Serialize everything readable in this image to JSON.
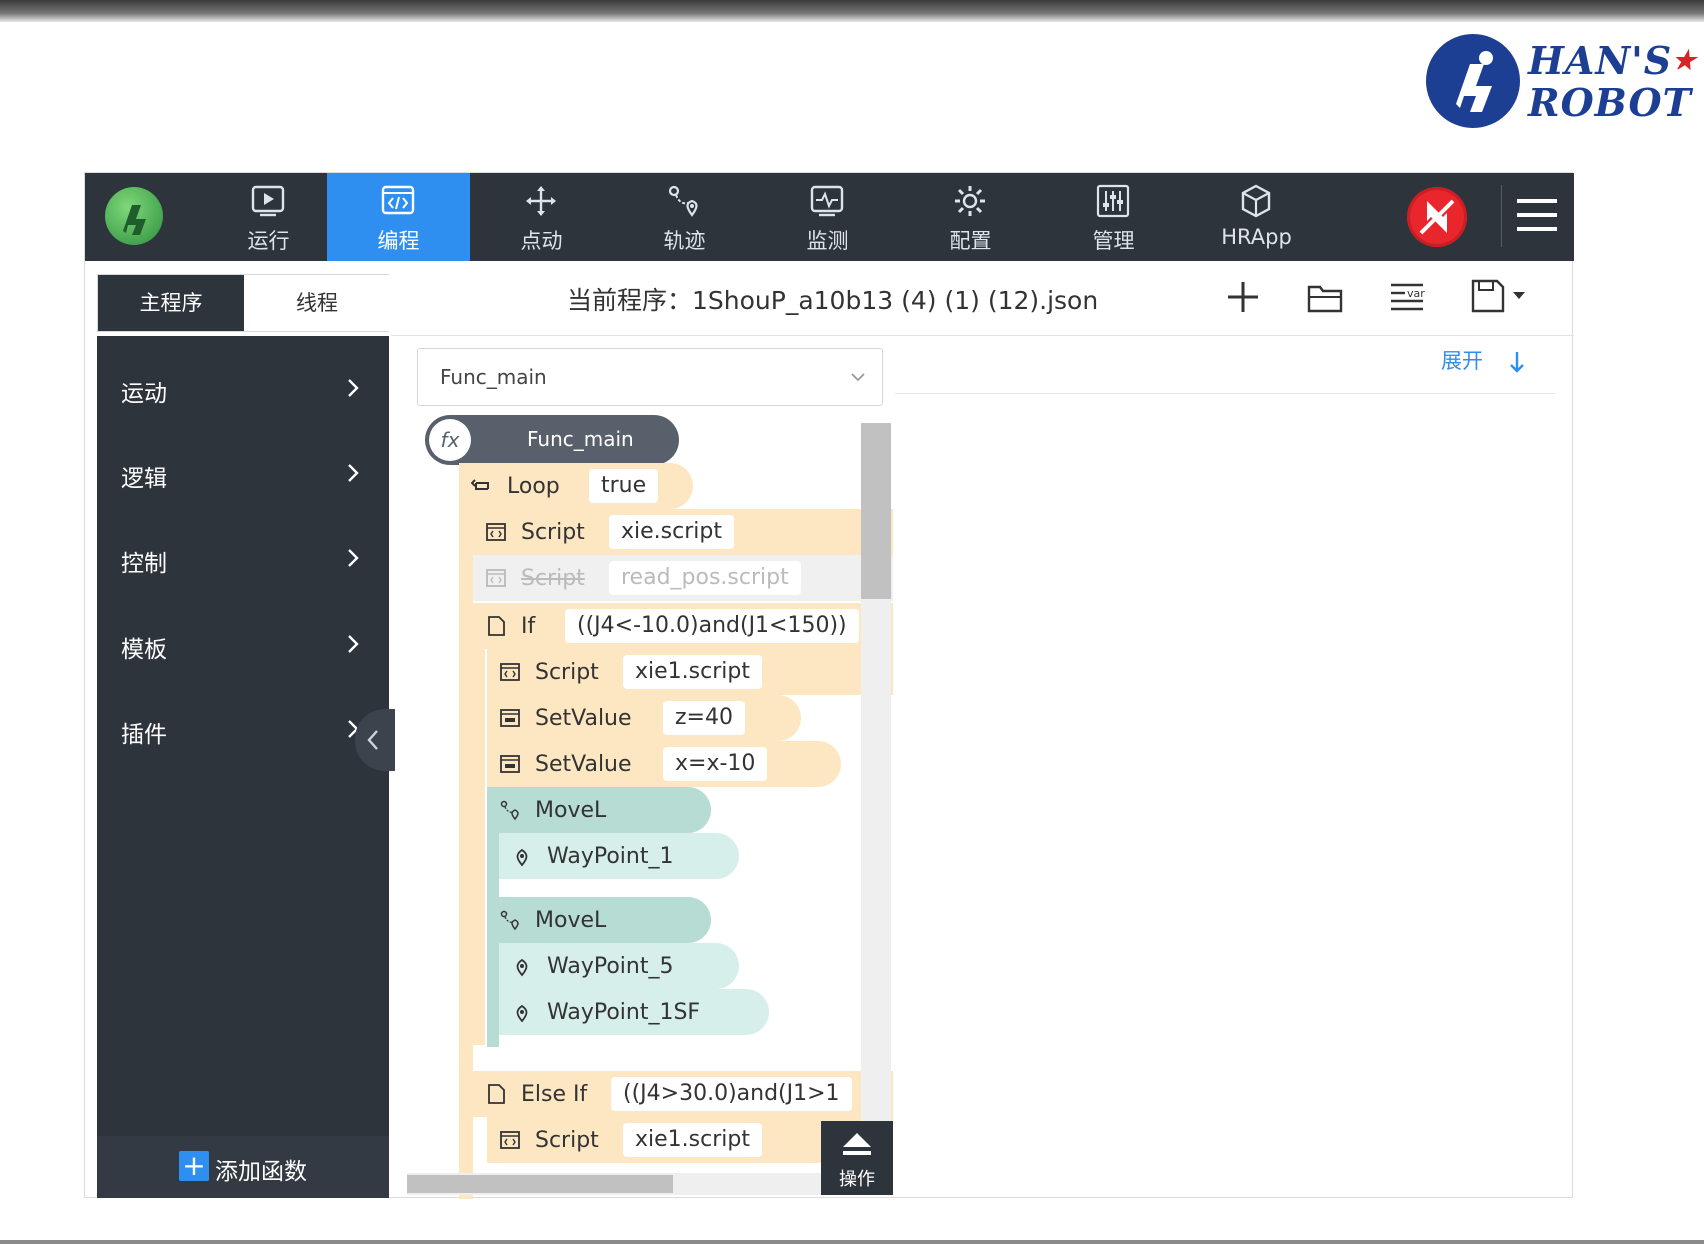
{
  "brand": {
    "line1": "HAN'S",
    "line2": "ROBOT",
    "color": "#1c3f94",
    "star_color": "#d6232a"
  },
  "nav": {
    "items": [
      {
        "label": "运行",
        "icon": "play-icon"
      },
      {
        "label": "编程",
        "icon": "code-icon",
        "active": true
      },
      {
        "label": "点动",
        "icon": "move-arrows-icon"
      },
      {
        "label": "轨迹",
        "icon": "trajectory-icon"
      },
      {
        "label": "监测",
        "icon": "monitor-icon"
      },
      {
        "label": "配置",
        "icon": "gear-icon"
      },
      {
        "label": "管理",
        "icon": "sliders-icon"
      },
      {
        "label": "HRApp",
        "icon": "cube-icon"
      }
    ],
    "accent": "#2f8ff0",
    "estop_color": "#e8262c"
  },
  "tabs": {
    "main": "主程序",
    "thread": "线程"
  },
  "sidebar": {
    "items": [
      "运动",
      "逻辑",
      "控制",
      "模板",
      "插件"
    ],
    "add_function": "添加函数"
  },
  "header": {
    "current_program": "当前程序：1ShouP_a10b13 (4) (1) (12).json"
  },
  "func_select": {
    "value": "Func_main"
  },
  "blocks": {
    "func": "Func_main",
    "loop": {
      "name": "Loop",
      "arg": "true"
    },
    "script1": {
      "name": "Script",
      "arg": "xie.script"
    },
    "script2": {
      "name": "Script",
      "arg": "read_pos.script"
    },
    "if": {
      "name": "If",
      "arg": "((J4<-10.0)and(J1<150))"
    },
    "script3": {
      "name": "Script",
      "arg": "xie1.script"
    },
    "setvalue1": {
      "name": "SetValue",
      "arg": "z=40"
    },
    "setvalue2": {
      "name": "SetValue",
      "arg": "x=x-10"
    },
    "movel1": {
      "name": "MoveL"
    },
    "wp1": "WayPoint_1",
    "movel2": {
      "name": "MoveL"
    },
    "wp5": "WayPoint_5",
    "wp1sf": "WayPoint_1SF",
    "elseif": {
      "name": "Else If",
      "arg": "((J4>30.0)and(J1>1"
    },
    "script4": {
      "name": "Script",
      "arg": "xie1.script"
    }
  },
  "ops": {
    "label": "操作"
  },
  "right_panel": {
    "expand": "展开"
  }
}
